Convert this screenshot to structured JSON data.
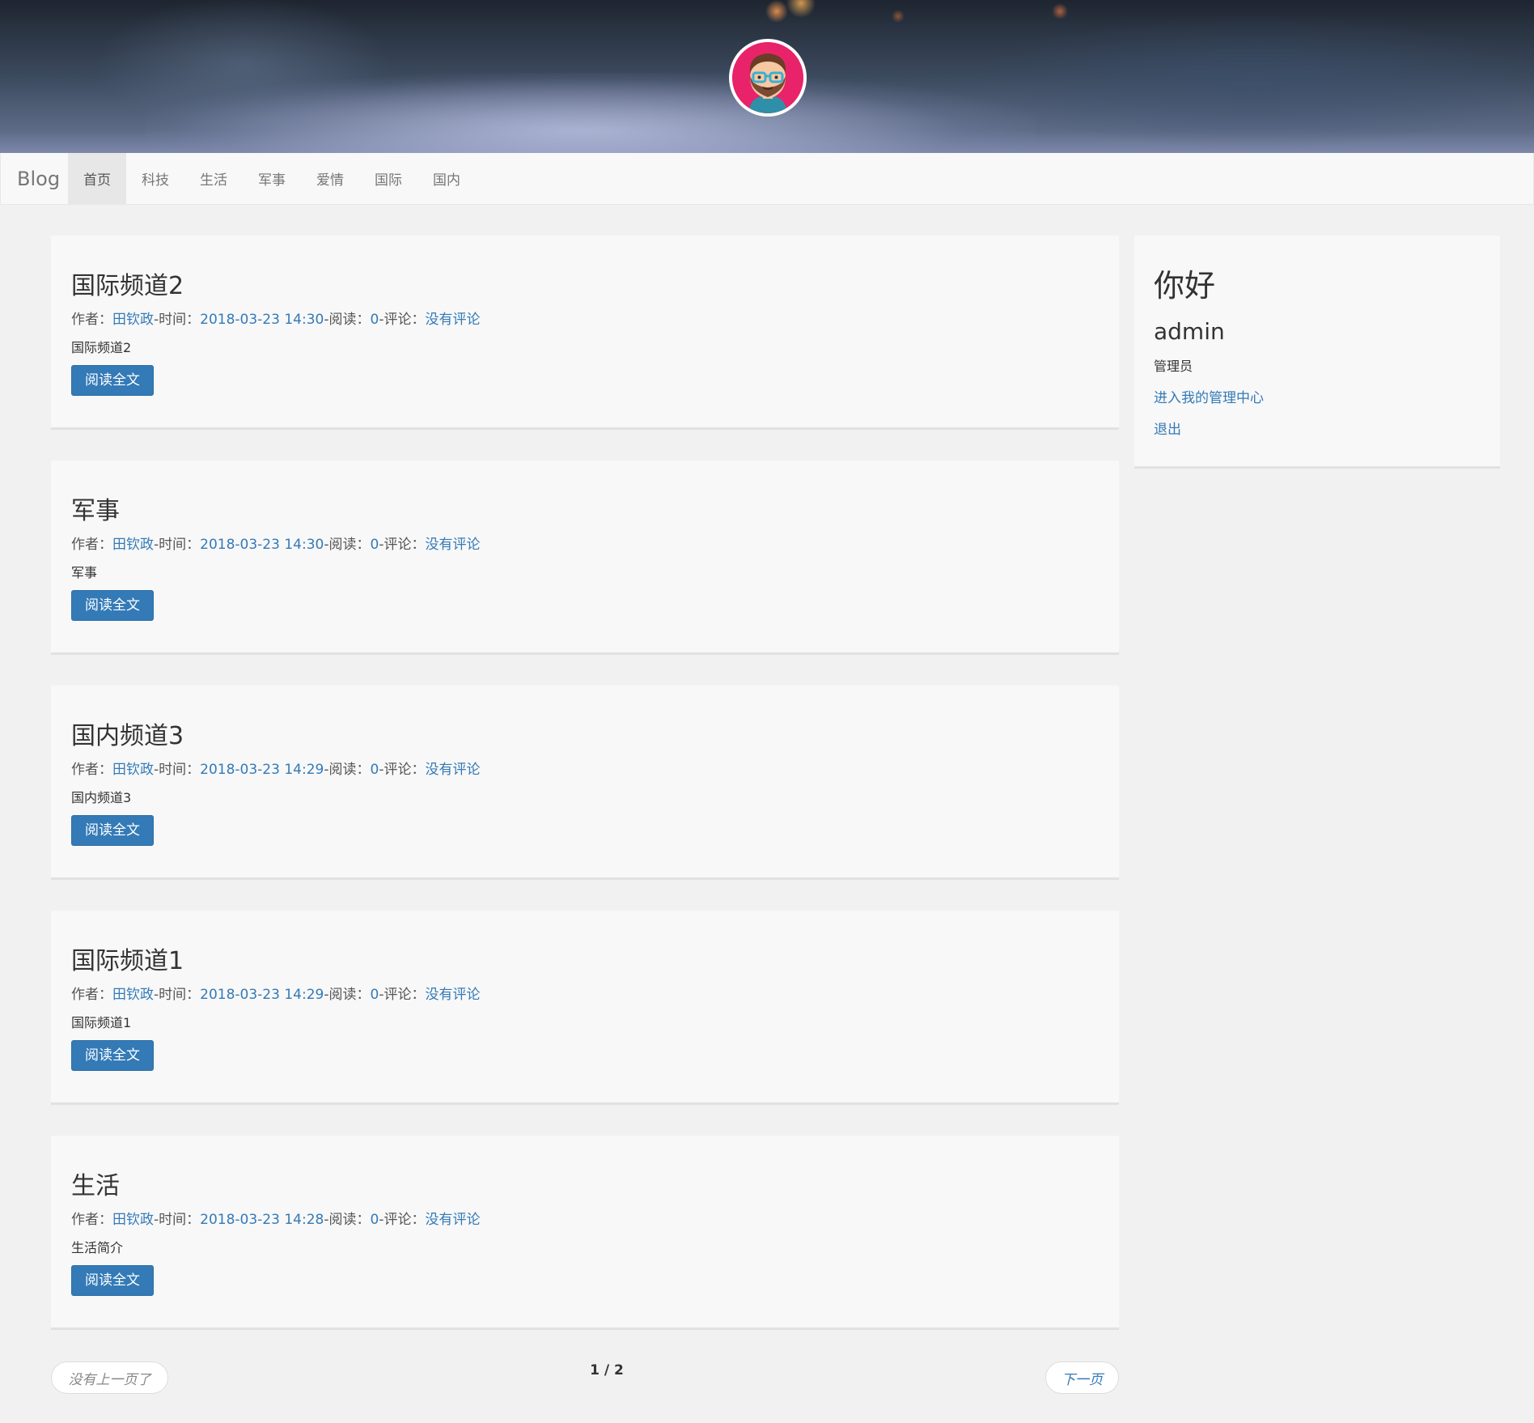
{
  "header": {
    "avatar_icon": "cartoon-man-avatar-icon"
  },
  "navbar": {
    "brand": "Blog",
    "items": [
      {
        "label": "首页",
        "active": true
      },
      {
        "label": "科技",
        "active": false
      },
      {
        "label": "生活",
        "active": false
      },
      {
        "label": "军事",
        "active": false
      },
      {
        "label": "爱情",
        "active": false
      },
      {
        "label": "国际",
        "active": false
      },
      {
        "label": "国内",
        "active": false
      }
    ]
  },
  "labels": {
    "author": "作者：",
    "time": "-时间：",
    "reads": "-阅读：",
    "comments": "-评论：",
    "read_more": "阅读全文"
  },
  "posts": [
    {
      "title": "国际频道2",
      "author": "田钦政",
      "time": "2018-03-23 14:30",
      "reads": "0",
      "comments": "没有评论",
      "summary": "国际频道2"
    },
    {
      "title": "军事",
      "author": "田钦政",
      "time": "2018-03-23 14:30",
      "reads": "0",
      "comments": "没有评论",
      "summary": "军事"
    },
    {
      "title": "国内频道3",
      "author": "田钦政",
      "time": "2018-03-23 14:29",
      "reads": "0",
      "comments": "没有评论",
      "summary": "国内频道3"
    },
    {
      "title": "国际频道1",
      "author": "田钦政",
      "time": "2018-03-23 14:29",
      "reads": "0",
      "comments": "没有评论",
      "summary": "国际频道1"
    },
    {
      "title": "生活",
      "author": "田钦政",
      "time": "2018-03-23 14:28",
      "reads": "0",
      "comments": "没有评论",
      "summary": "生活简介"
    }
  ],
  "sidebar": {
    "greeting": "你好",
    "username": "admin",
    "role": "管理员",
    "admin_link": "进入我的管理中心",
    "logout": "退出"
  },
  "pager": {
    "prev": "没有上一页了",
    "info": "1 / 2",
    "next": "下一页"
  },
  "colors": {
    "link": "#337ab7",
    "button": "#337ab7",
    "avatar_bg": "#e8236a",
    "page_bg": "#f1f1f1"
  }
}
